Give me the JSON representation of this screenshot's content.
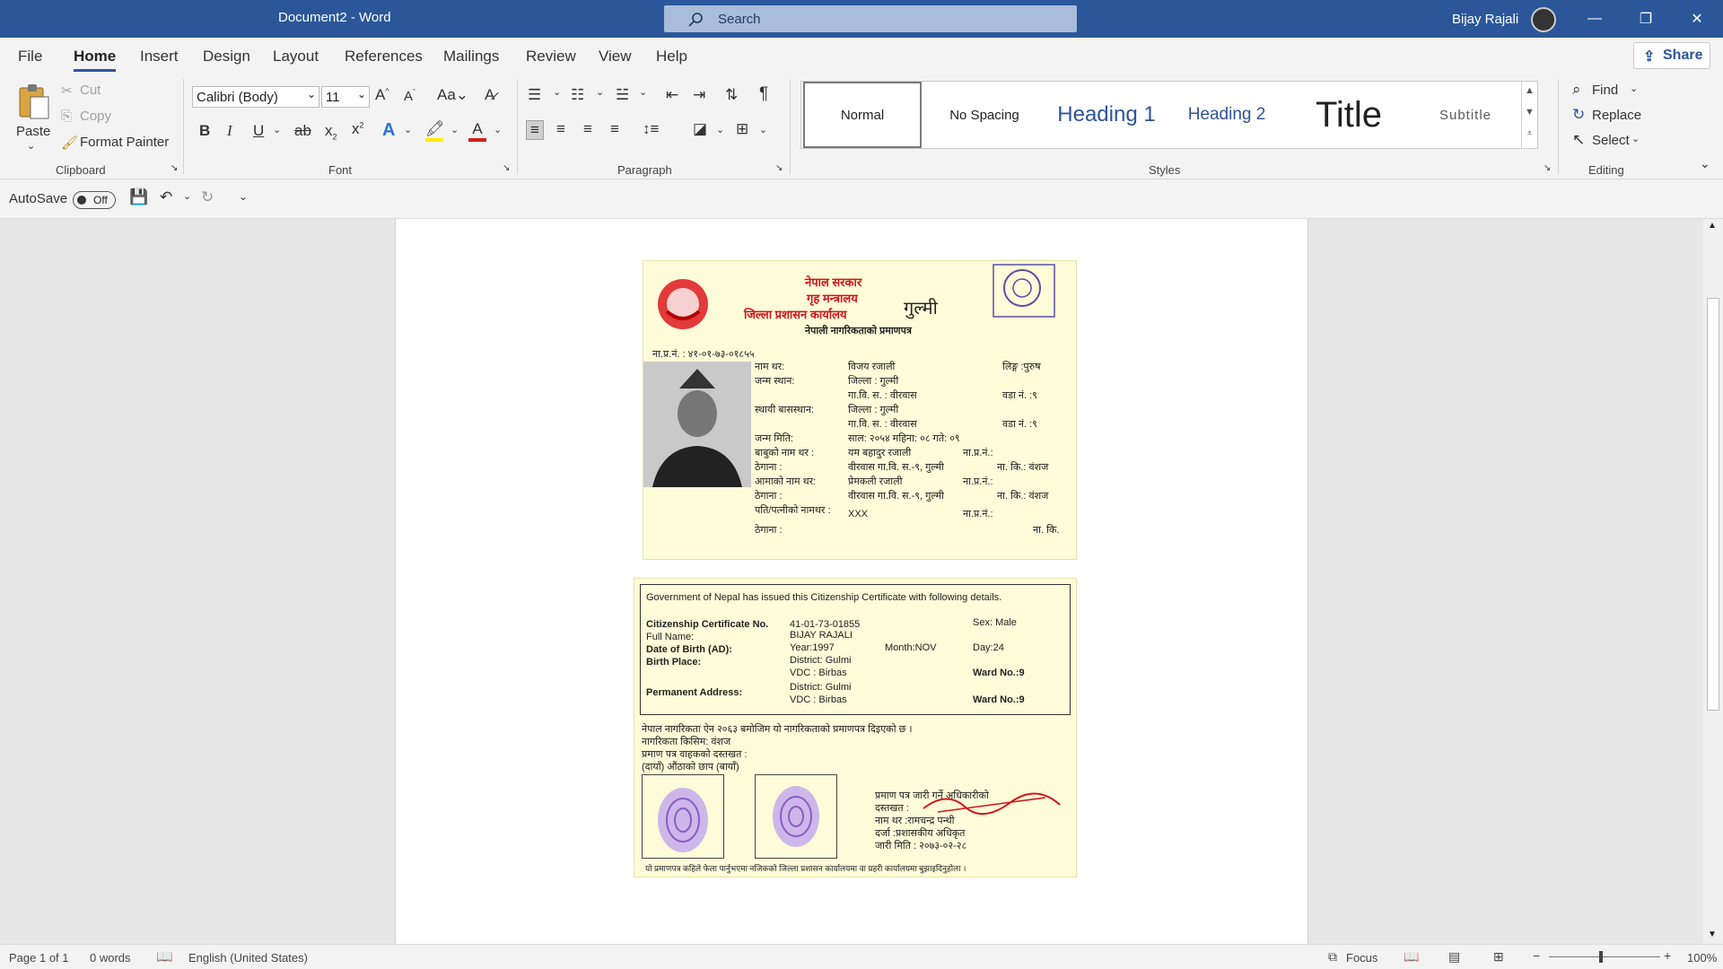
{
  "titlebar": {
    "doc_title": "Document2  -  Word",
    "search_placeholder": "Search",
    "user_name": "Bijay Rajali"
  },
  "menu": [
    "File",
    "Home",
    "Insert",
    "Design",
    "Layout",
    "References",
    "Mailings",
    "Review",
    "View",
    "Help"
  ],
  "share_label": "Share",
  "clipboard": {
    "paste": "Paste",
    "cut": "Cut",
    "copy": "Copy",
    "format_painter": "Format Painter",
    "label": "Clipboard"
  },
  "font": {
    "name": "Calibri (Body)",
    "size": "11",
    "label": "Font"
  },
  "paragraph": {
    "label": "Paragraph"
  },
  "styles": {
    "items": [
      "Normal",
      "No Spacing",
      "Heading 1",
      "Heading 2",
      "Title",
      "Subtitle"
    ],
    "label": "Styles"
  },
  "editing": {
    "find": "Find",
    "replace": "Replace",
    "select": "Select",
    "label": "Editing"
  },
  "qat": {
    "autosave": "AutoSave",
    "toggle": "Off"
  },
  "cert_top": {
    "gov": "नेपाल सरकार",
    "ministry": "गृह मन्त्रालय",
    "office": "जिल्ला प्रशासन कार्यालय",
    "district_hand": "गुल्मी",
    "title": "नेपाली नागरिकताको प्रमाणपत्र",
    "nagari_no": "ना.प्र.नं. : ४१-०१-७३-०१८५५",
    "rows": [
      {
        "label": "नाम थर:",
        "value": "विजय रजाली",
        "extra": "लिङ्ग :पुरुष"
      },
      {
        "label": "जन्म स्थान:",
        "value": "जिल्ला : गुल्मी",
        "extra": ""
      },
      {
        "label": "",
        "value": "गा.वि. स. : वीरवास",
        "extra": "वडा नं. :९"
      },
      {
        "label": "स्थायी बासस्थान:",
        "value": "जिल्ला : गुल्मी",
        "extra": ""
      },
      {
        "label": "",
        "value": "गा.वि. स. : वीरवास",
        "extra": "वडा नं. :९"
      },
      {
        "label": "जन्म मिति:",
        "value": "साल: २०५४  महिना: ०८  गते: ०९",
        "extra": ""
      },
      {
        "label": "बाबुको नाम थर :",
        "value": "यम बहादुर रजाली",
        "extra": "ना.प्र.नं.:"
      },
      {
        "label": "ठेगाना :",
        "value": "वीरवास गा.वि. स.-९, गुल्मी",
        "extra": "ना. कि.: वंशज"
      },
      {
        "label": "आमाको नाम थर:",
        "value": "प्रेमकली रजाली",
        "extra": "ना.प्र.नं.:"
      },
      {
        "label": "ठेगाना :",
        "value": "वीरवास गा.वि. स.-९, गुल्मी",
        "extra": "ना. कि.: वंशज"
      },
      {
        "label": "पति/पत्नीको नामथर :",
        "value": "XXX",
        "extra": "ना.प्र.नं.:"
      },
      {
        "label": "ठेगाना :",
        "value": "",
        "extra": "ना. कि."
      }
    ]
  },
  "cert_bottom": {
    "intro": "Government of Nepal has issued this Citizenship Certificate with following details.",
    "cert_no_label": "Citizenship Certificate No.",
    "cert_no": "41-01-73-01855",
    "sex": "Sex: Male",
    "name_label": "Full Name:",
    "name": "BIJAY RAJALI",
    "dob_label": "Date of Birth (AD):",
    "year": "Year:1997",
    "month": "Month:NOV",
    "day": "Day:24",
    "birth_place_label": "Birth Place:",
    "district1": "District: Gulmi",
    "vdc1": "VDC : Birbas",
    "perm_label": "Permanent Address:",
    "district2": "District: Gulmi",
    "vdc2": "VDC : Birbas",
    "ward1": "Ward No.:9",
    "ward2": "Ward No.:9",
    "np1": "नेपाल नागरिकता ऐन २०६३ बमोजिम यो नागरिकताको प्रमाणपत्र दिइएको छ ।",
    "np2": "नागरिकता किसिम: वंशज",
    "np3": "प्रमाण पत्र वाहकको दस्तखत :",
    "np4": "(दायाँ)    औंठाको छाप    (बायाँ)",
    "off1": "प्रमाण पत्र जारी गर्ने अधिकारीको",
    "off2": "दस्तखत :",
    "off3": "नाम थर :रामचन्द्र पन्थी",
    "off4": "दर्जा :प्रशासकीय अधिकृत",
    "off5": "जारी मिति : २०७३-०२-२८",
    "footer": "यो प्रमाणपत्र कहिले फेला पार्नुभएमा नजिकको जिल्ला प्रशासन कार्यालयमा वा प्रहरी कार्यालयमा बुझाइदिनुहोला ।"
  },
  "status": {
    "page": "Page 1 of 1",
    "words": "0 words",
    "lang": "English (United States)",
    "focus": "Focus",
    "zoom": "100%"
  },
  "colors": {
    "brand": "#2b579a",
    "heading": "#2f5496",
    "cert_red": "#d0141c"
  }
}
